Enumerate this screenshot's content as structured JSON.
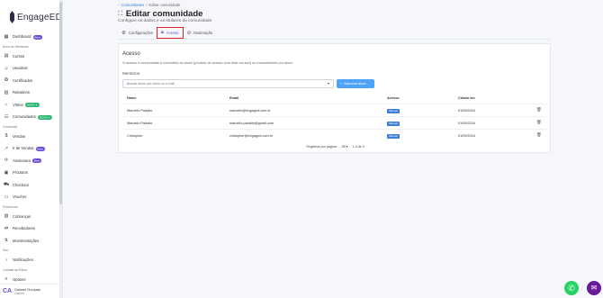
{
  "app": {
    "logo_text": "EngageED"
  },
  "sidebar": {
    "sections": [
      {
        "title": "Dashboard",
        "items": [
          {
            "label": "Dashboard",
            "icon": "dashboard-icon",
            "badge": "Beta"
          }
        ]
      },
      {
        "title": "Área de Membros",
        "items": [
          {
            "label": "Cursos",
            "icon": "book-icon"
          },
          {
            "label": "Usuários",
            "icon": "users-icon"
          },
          {
            "label": "Certificados",
            "icon": "certificate-icon"
          },
          {
            "label": "Relatórios",
            "icon": "report-icon"
          },
          {
            "label": "Vitrine",
            "icon": "store-icon",
            "badge": "NOVO ✦"
          },
          {
            "label": "Comunidades",
            "icon": "community-icon",
            "badge": "NOVO ✦"
          }
        ]
      },
      {
        "title": "Comercial",
        "items": [
          {
            "label": "Vendas",
            "icon": "money-icon"
          },
          {
            "label": "Ir de Vendas",
            "icon": "chart-icon",
            "badge": "Beta"
          },
          {
            "label": "Assinatura",
            "icon": "subscription-icon",
            "badge": "Beta"
          },
          {
            "label": "Produtos",
            "icon": "box-icon"
          },
          {
            "label": "Checkout",
            "icon": "cart-icon"
          },
          {
            "label": "Voucher",
            "icon": "voucher-icon"
          }
        ]
      },
      {
        "title": "Financeiro",
        "items": [
          {
            "label": "Cobranças",
            "icon": "billing-icon"
          },
          {
            "label": "Recebedores",
            "icon": "receiver-icon"
          },
          {
            "label": "Movimentações",
            "icon": "transactions-icon"
          }
        ]
      },
      {
        "title": "Seu",
        "items": [
          {
            "label": "Notificações",
            "icon": "bell-icon"
          }
        ]
      },
      {
        "title": "Cadastros/Tribos",
        "items": [
          {
            "label": "Options",
            "icon": "options-icon"
          }
        ]
      }
    ],
    "user": {
      "name": "Gabriel Gonçalo",
      "role": "Gabriel"
    }
  },
  "breadcrumb": {
    "parent": "Comunidades",
    "separator": "/",
    "current": "Editar comunidade"
  },
  "page": {
    "title": "Editar comunidade",
    "subtitle": "Configure os dados e os titulares da comunidade"
  },
  "tabs": [
    {
      "label": "Configurações",
      "icon": "gear-icon",
      "active": false
    },
    {
      "label": "Acesso",
      "icon": "lock-icon",
      "active": true
    },
    {
      "label": "Moderação",
      "icon": "moderation-icon",
      "active": false
    }
  ],
  "card": {
    "title": "Acesso",
    "description": "O acesso à comunidade é concedido ao aluno (produto de acesso com este recurso) ou manualmente por aluno.",
    "members_label": "Membros",
    "search_placeholder": "Buscar aluno por nome ou e-mail",
    "add_button": "Adicionar aluno"
  },
  "table": {
    "headers": [
      "Nome",
      "Email",
      "Acesso",
      "Criado em"
    ],
    "rows": [
      {
        "name": "Marcello Padalto",
        "email": "marcello@engaged.com.br",
        "access": "Manual",
        "created": "01/09/2024"
      },
      {
        "name": "Marcello Padalto",
        "email": "marcello.padalto@gmail.com",
        "access": "Manual",
        "created": "01/09/2024"
      },
      {
        "name": "Cristopher",
        "email": "cristopher@engaged.com.br",
        "access": "Manual",
        "created": "01/09/2024"
      }
    ],
    "pagination": {
      "label": "Registros por página:",
      "per_page": "25",
      "range": "1-3 de 3"
    }
  },
  "colors": {
    "accent": "#6a4bd8",
    "primary_button": "#4fa3f7",
    "tag_blue": "#3b7fd8",
    "whatsapp": "#25d366"
  }
}
